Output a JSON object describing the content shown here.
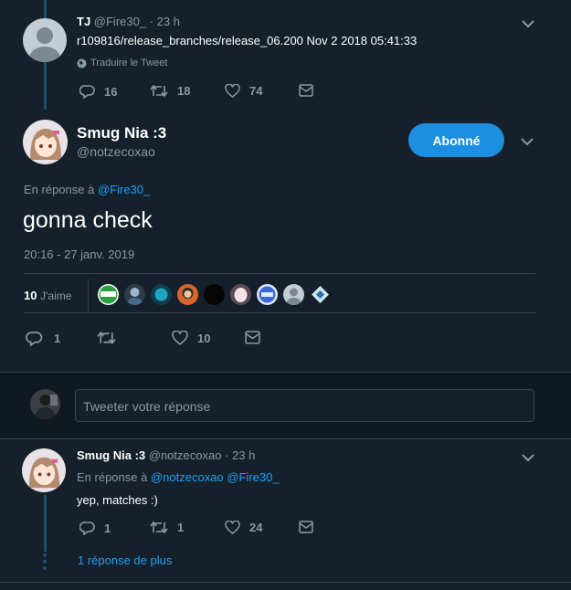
{
  "tweet1": {
    "name": "TJ",
    "handle": "@Fire30_",
    "time": "· 23 h",
    "text": "r109816/release_branches/release_06.200 Nov  2 2018 05:41:33",
    "translate": "Traduire le Tweet",
    "replies": "16",
    "retweets": "18",
    "likes": "74"
  },
  "main": {
    "name": "Smug Nia :3",
    "handle": "@notzecoxao",
    "follow_label": "Abonné",
    "reply_prefix": "En réponse à",
    "reply_to": "@Fire30_",
    "text": "gonna check",
    "timestamp": "20:16 - 27 janv. 2019",
    "likes_count": "10",
    "likes_label": "J'aime",
    "replies": "1",
    "retweets": "",
    "likes": "10"
  },
  "composer": {
    "placeholder": "Tweeter votre réponse"
  },
  "reply": {
    "name": "Smug Nia :3",
    "handle": "@notzecoxao",
    "time": "· 23 h",
    "reply_prefix": "En réponse à",
    "reply_to_1": "@notzecoxao",
    "reply_to_2": "@Fire30_",
    "text": "yep, matches :)",
    "replies": "1",
    "retweets": "1",
    "likes": "24",
    "more_replies": "1 réponse de plus"
  },
  "colors": {
    "background": "#15202b",
    "accent": "#1da1f2",
    "muted": "#8899a6",
    "divider": "#38444d"
  }
}
